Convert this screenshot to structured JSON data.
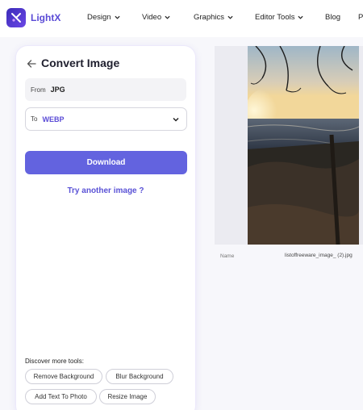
{
  "brand": {
    "name": "LightX",
    "logo_icon": "lightx-logo-icon",
    "accent": "#5a4bd6"
  },
  "nav": {
    "items": [
      {
        "label": "Design",
        "has_dropdown": true
      },
      {
        "label": "Video",
        "has_dropdown": true
      },
      {
        "label": "Graphics",
        "has_dropdown": true
      },
      {
        "label": "Editor Tools",
        "has_dropdown": true
      },
      {
        "label": "Blog",
        "has_dropdown": false
      },
      {
        "label": "P",
        "has_dropdown": false
      }
    ]
  },
  "converter": {
    "title": "Convert Image",
    "from_label": "From",
    "from_value": "JPG",
    "to_label": "To",
    "to_value": "WEBP",
    "download_label": "Download",
    "download_color": "#6363df",
    "try_another_label": "Try another image ?"
  },
  "tools": {
    "heading": "Discover more tools:",
    "chips": [
      "Remove Background",
      "Blur Background",
      "Add Text To Photo",
      "Resize Image"
    ]
  },
  "preview": {
    "name_label": "Name",
    "file_name": "listoffreeware_image_ (2).jpg"
  }
}
